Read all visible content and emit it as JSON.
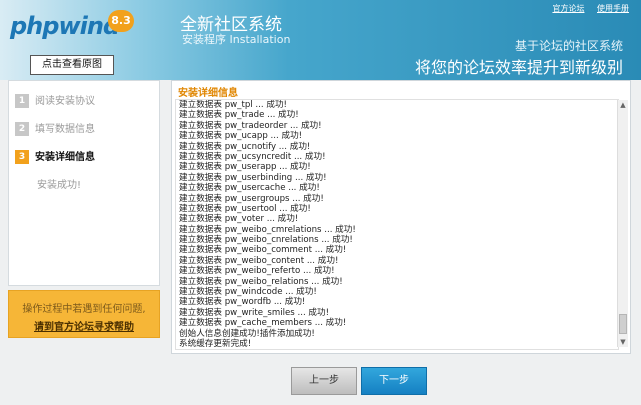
{
  "header": {
    "logo": "phpwind",
    "version_badge": "8.3",
    "title": "全新社区系统",
    "subtitle": "安装程序 Installation",
    "links": [
      "官方论坛",
      "使用手册"
    ],
    "slogan_small": "基于论坛的社区系统",
    "slogan_large": "将您的论坛效率提升到新级别",
    "view_original": "点击查看原图"
  },
  "sidebar": {
    "steps": [
      {
        "num": "1",
        "label": "阅读安装协议",
        "state": "done"
      },
      {
        "num": "2",
        "label": "填写数据信息",
        "state": "done"
      },
      {
        "num": "3",
        "label": "安装详细信息",
        "state": "active"
      },
      {
        "num": "",
        "label": "安装成功!",
        "state": "future"
      }
    ],
    "help_text": "操作过程中若遇到任何问题,",
    "help_link": "请到官方论坛寻求帮助"
  },
  "panel": {
    "title": "安装详细信息",
    "log": [
      "建立数据表 pw_tpl ... 成功!",
      "建立数据表 pw_trade ... 成功!",
      "建立数据表 pw_tradeorder ... 成功!",
      "建立数据表 pw_ucapp ... 成功!",
      "建立数据表 pw_ucnotify ... 成功!",
      "建立数据表 pw_ucsyncredit ... 成功!",
      "建立数据表 pw_userapp ... 成功!",
      "建立数据表 pw_userbinding ... 成功!",
      "建立数据表 pw_usercache ... 成功!",
      "建立数据表 pw_usergroups ... 成功!",
      "建立数据表 pw_usertool ... 成功!",
      "建立数据表 pw_voter ... 成功!",
      "建立数据表 pw_weibo_cmrelations ... 成功!",
      "建立数据表 pw_weibo_cnrelations ... 成功!",
      "建立数据表 pw_weibo_comment ... 成功!",
      "建立数据表 pw_weibo_content ... 成功!",
      "建立数据表 pw_weibo_referto ... 成功!",
      "建立数据表 pw_weibo_relations ... 成功!",
      "建立数据表 pw_windcode ... 成功!",
      "建立数据表 pw_wordfb ... 成功!",
      "建立数据表 pw_write_smiles ... 成功!",
      "建立数据表 pw_cache_members ... 成功!",
      "创始人信息创建成功!插件添加成功!",
      "系统缓存更新完成!"
    ]
  },
  "buttons": {
    "prev": "上一步",
    "next": "下一步"
  }
}
